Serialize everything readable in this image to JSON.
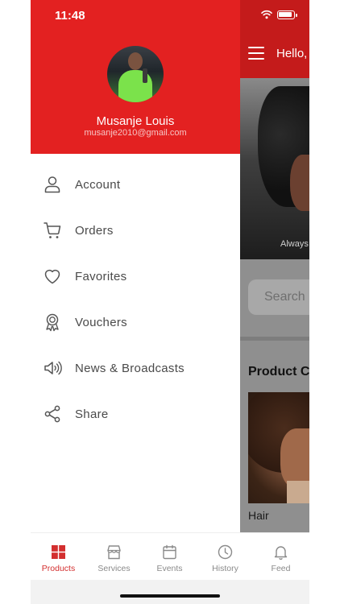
{
  "status_bar": {
    "time": "11:48"
  },
  "background_screen": {
    "greeting": "Hello,",
    "hero_caption": "Always",
    "search_placeholder": "Search",
    "section_title": "Product C",
    "product_label": "Hair"
  },
  "drawer": {
    "user": {
      "name": "Musanje Louis",
      "email": "musanje2010@gmail.com"
    },
    "menu": [
      {
        "label": "Account",
        "icon": "person-icon"
      },
      {
        "label": "Orders",
        "icon": "cart-icon"
      },
      {
        "label": "Favorites",
        "icon": "heart-icon"
      },
      {
        "label": "Vouchers",
        "icon": "ribbon-icon"
      },
      {
        "label": "News & Broadcasts",
        "icon": "speaker-icon"
      },
      {
        "label": "Share",
        "icon": "share-icon"
      }
    ]
  },
  "tabbar": {
    "active": "Products",
    "active_color": "#d32f2f",
    "inactive_color": "#8a8a8a",
    "tabs": [
      {
        "label": "Products",
        "icon": "grid-icon"
      },
      {
        "label": "Services",
        "icon": "store-icon"
      },
      {
        "label": "Events",
        "icon": "calendar-icon"
      },
      {
        "label": "History",
        "icon": "clock-icon"
      },
      {
        "label": "Feed",
        "icon": "bell-icon"
      }
    ]
  },
  "colors": {
    "drawer_header": "#e32121",
    "app_header": "#c41b1b"
  }
}
